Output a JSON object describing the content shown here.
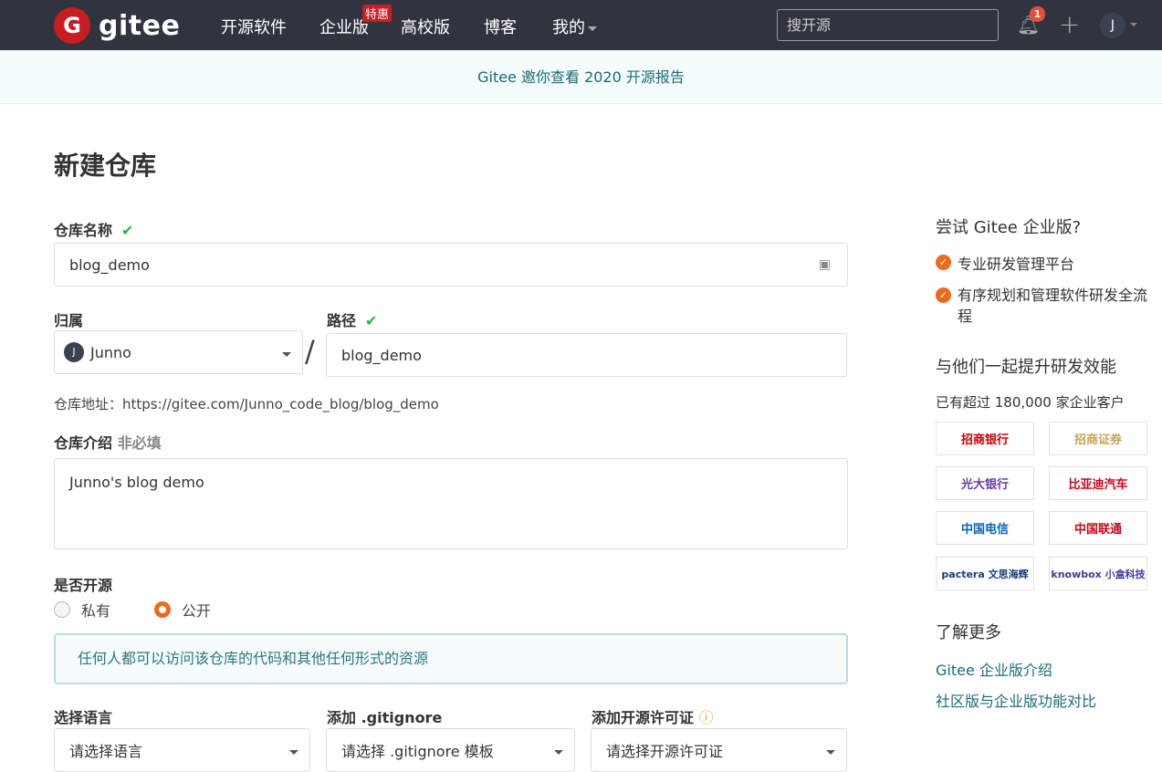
{
  "nav": {
    "logo_letter": "G",
    "logo_text": "gitee",
    "items": [
      "开源软件",
      "企业版",
      "高校版",
      "博客",
      "我的"
    ],
    "badge": "特惠",
    "search_placeholder": "搜开源",
    "notif_count": "1",
    "avatar": "J"
  },
  "banner": "Gitee 邀你查看 2020 开源报告",
  "page_title": "新建仓库",
  "form": {
    "name_label": "仓库名称",
    "name_value": "blog_demo",
    "owner_label": "归属",
    "owner_value": "Junno",
    "owner_avatar": "J",
    "path_label": "路径",
    "path_value": "blog_demo",
    "slash": "/",
    "address": "仓库地址：https://gitee.com/Junno_code_blog/blog_demo",
    "desc_label": "仓库介绍",
    "desc_optional": "非必填",
    "desc_value": "Junno's blog demo",
    "open_label": "是否开源",
    "private": "私有",
    "public": "公开",
    "public_info": "任何人都可以访问该仓库的代码和其他任何形式的资源",
    "lang_label": "选择语言",
    "lang_value": "请选择语言",
    "gitignore_label": "添加 .gitignore",
    "gitignore_value": "请选择 .gitignore 模板",
    "license_label": "添加开源许可证",
    "license_value": "请选择开源许可证"
  },
  "side": {
    "try_title": "尝试 Gitee 企业版?",
    "features": [
      "专业研发管理平台",
      "有序规划和管理软件研发全流程"
    ],
    "together_title": "与他们一起提升研发效能",
    "customers": "已有超过 180,000 家企业客户",
    "logos": [
      "招商银行",
      "招商证券",
      "光大银行",
      "比亚迪汽车",
      "中国电信",
      "中国联通",
      "pactera 文思海辉",
      "knowbox 小盒科技"
    ],
    "more_title": "了解更多",
    "links": [
      "Gitee 企业版介绍",
      "社区版与企业版功能对比"
    ]
  }
}
